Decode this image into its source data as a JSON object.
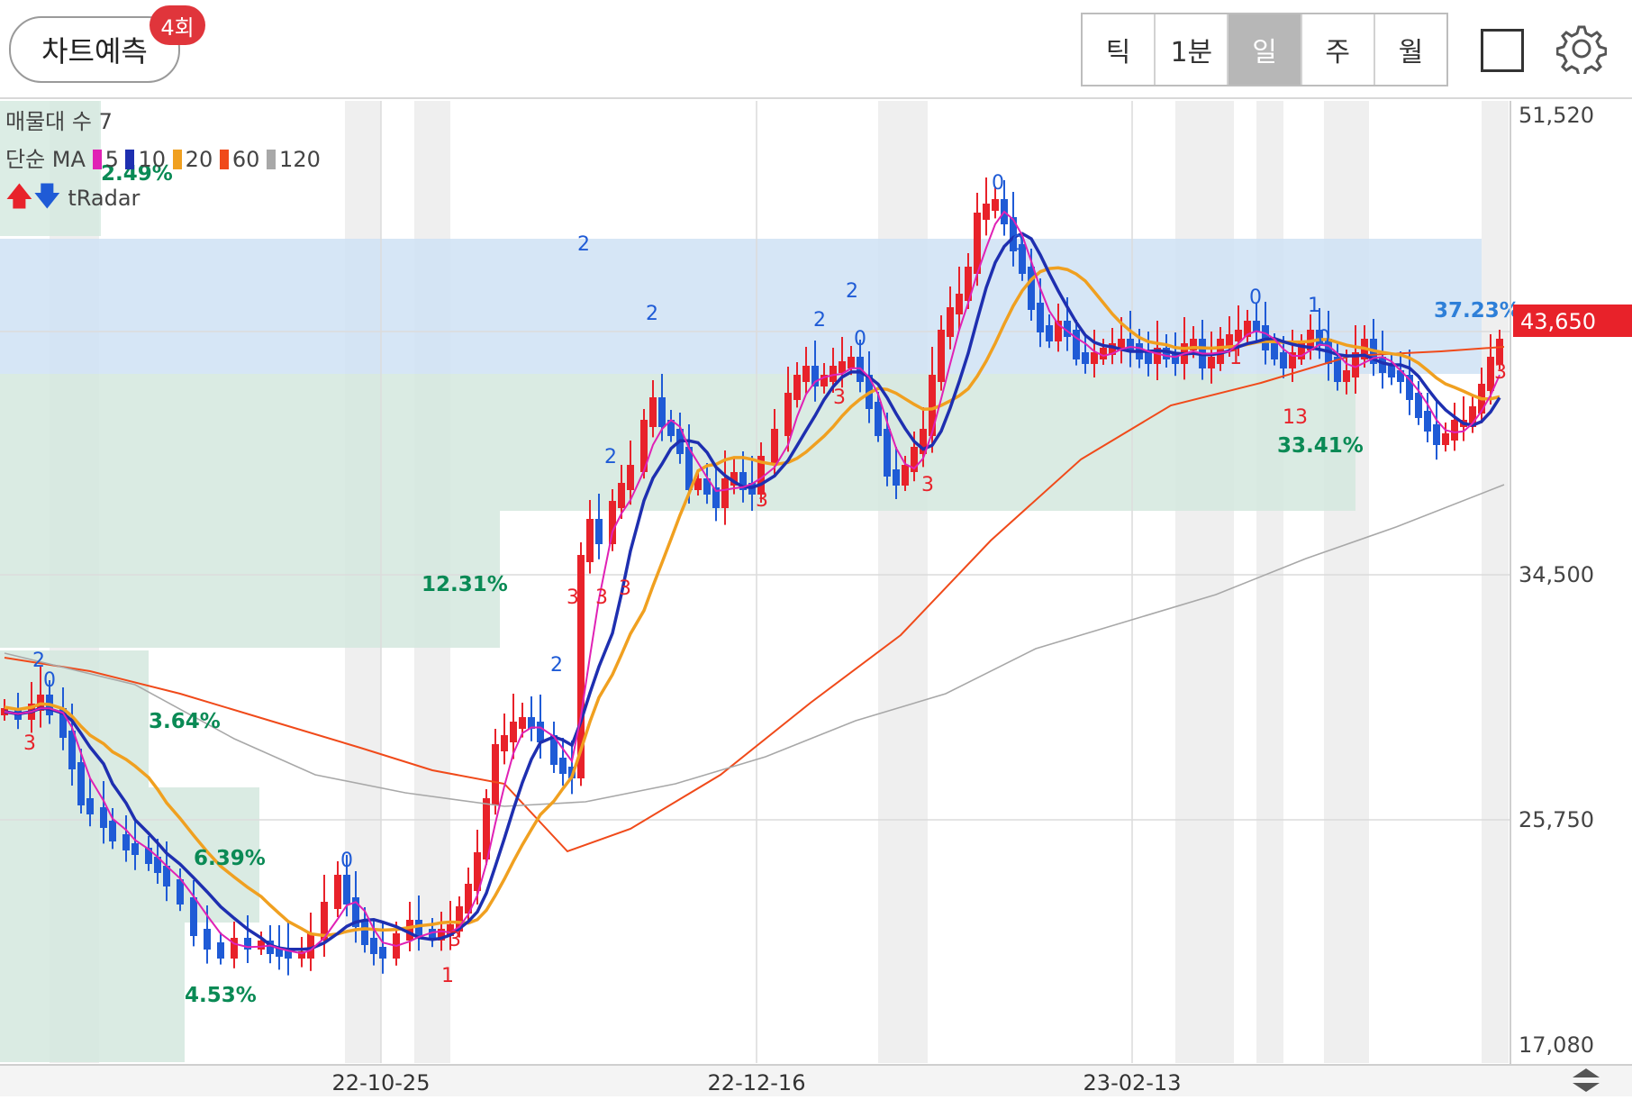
{
  "header": {
    "predict_button": "차트예측",
    "predict_badge": "4회",
    "timeframes": [
      {
        "label": "틱",
        "active": false
      },
      {
        "label": "1분",
        "active": false
      },
      {
        "label": "일",
        "active": true
      },
      {
        "label": "주",
        "active": false
      },
      {
        "label": "월",
        "active": false
      }
    ]
  },
  "legend": {
    "volume_profile": "매물대 수 7",
    "ma_label": "단순 MA",
    "ma_items": [
      {
        "period": "5",
        "color": "#e021b5"
      },
      {
        "period": "10",
        "color": "#1e2fb0"
      },
      {
        "period": "20",
        "color": "#f0a020"
      },
      {
        "period": "60",
        "color": "#f04a1a"
      },
      {
        "period": "120",
        "color": "#a8a8a8"
      }
    ],
    "tradar": "tRadar"
  },
  "chart_data": {
    "type": "candlestick",
    "y_axis_labels": [
      "51,520",
      "34,500",
      "25,750",
      "17,080"
    ],
    "ylim": [
      17080,
      51520
    ],
    "x_axis_labels": [
      "22-10-25",
      "22-12-16",
      "23-02-13"
    ],
    "current_price": "43,650",
    "price_colors": {
      "up": "#e8222a",
      "down": "#1f5bd6"
    },
    "volume_profile_percents": [
      "2.49%",
      "3.64%",
      "6.39%",
      "4.53%",
      "12.31%",
      "33.41%",
      "37.23%"
    ],
    "signal_marks": [
      "2",
      "0",
      "3",
      "0",
      "1",
      "3",
      "2",
      "3",
      "3",
      "3",
      "2",
      "2",
      "2",
      "2",
      "0",
      "3",
      "3",
      "3",
      "0",
      "0",
      "2",
      "0",
      "1",
      "1",
      "0",
      "13",
      "3"
    ]
  }
}
